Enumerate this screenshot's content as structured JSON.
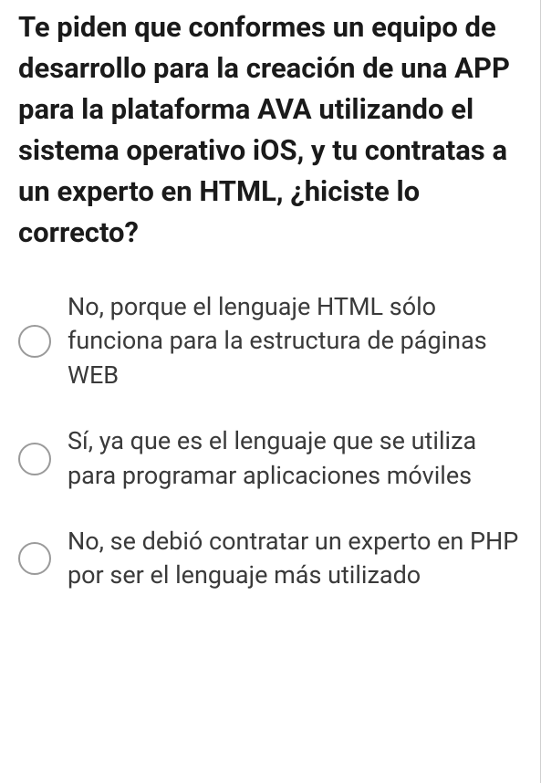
{
  "question": "Te piden que conformes un equipo de desarrollo para la creación de una APP para la plataforma AVA utilizando el sistema operativo iOS, y tu contratas a un experto en HTML, ¿hiciste lo correcto?",
  "options": [
    {
      "label": "No, porque el lenguaje HTML sólo funciona para la estructura de páginas WEB"
    },
    {
      "label": "Sí, ya que es el lenguaje que se utiliza para programar aplicaciones móviles"
    },
    {
      "label": "No, se debió contratar un experto en PHP por ser el lenguaje más utilizado"
    }
  ]
}
